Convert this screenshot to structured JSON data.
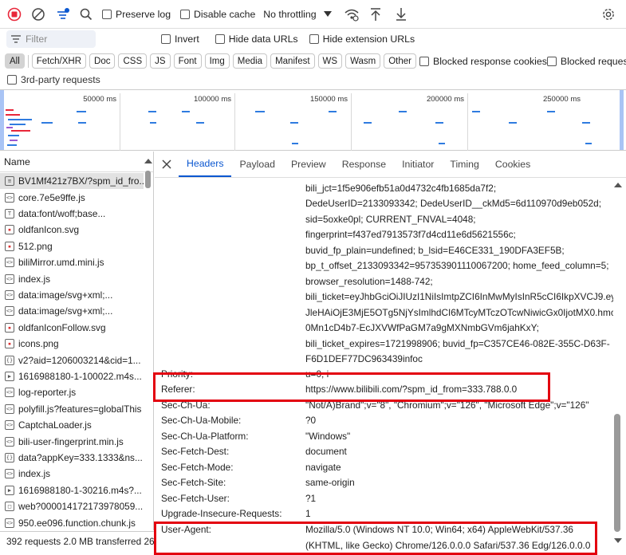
{
  "toolbar": {
    "preserve_log": "Preserve log",
    "disable_cache": "Disable cache",
    "throttling": "No throttling"
  },
  "filter": {
    "placeholder": "Filter",
    "invert": "Invert",
    "hide_data_urls": "Hide data URLs",
    "hide_extension_urls": "Hide extension URLs"
  },
  "types": [
    "All",
    "Fetch/XHR",
    "Doc",
    "CSS",
    "JS",
    "Font",
    "Img",
    "Media",
    "Manifest",
    "WS",
    "Wasm",
    "Other"
  ],
  "blocked_response_cookies": "Blocked response cookies",
  "blocked_requests": "Blocked requests",
  "third_party": "3rd-party requests",
  "overview_ticks": [
    "50000 ms",
    "100000 ms",
    "150000 ms",
    "200000 ms",
    "250000 ms"
  ],
  "name_header": "Name",
  "files": [
    {
      "name": "BV1Mf421z7BX/?spm_id_fro...",
      "icon": "document-icon",
      "selected": true
    },
    {
      "name": "core.7e5e9ffe.js",
      "icon": "script-icon"
    },
    {
      "name": "data:font/woff;base...",
      "icon": "font-icon"
    },
    {
      "name": "oldfanIcon.svg",
      "icon": "image-icon"
    },
    {
      "name": "512.png",
      "icon": "image-icon"
    },
    {
      "name": "biliMirror.umd.mini.js",
      "icon": "script-icon"
    },
    {
      "name": "index.js",
      "icon": "script-icon"
    },
    {
      "name": "data:image/svg+xml;...",
      "icon": "script-icon"
    },
    {
      "name": "data:image/svg+xml;...",
      "icon": "script-icon"
    },
    {
      "name": "oldfanIconFollow.svg",
      "icon": "image-icon"
    },
    {
      "name": "icons.png",
      "icon": "image-icon"
    },
    {
      "name": "v2?aid=1206003214&cid=1...",
      "icon": "fetch-icon"
    },
    {
      "name": "1616988180-1-100022.m4s...",
      "icon": "media-icon"
    },
    {
      "name": "log-reporter.js",
      "icon": "script-icon"
    },
    {
      "name": "polyfill.js?features=globalThis",
      "icon": "script-icon"
    },
    {
      "name": "CaptchaLoader.js",
      "icon": "script-icon"
    },
    {
      "name": "bili-user-fingerprint.min.js",
      "icon": "script-icon"
    },
    {
      "name": "data?appKey=333.1333&ns...",
      "icon": "fetch-icon"
    },
    {
      "name": "index.js",
      "icon": "script-icon"
    },
    {
      "name": "1616988180-1-30216.m4s?...",
      "icon": "media-icon"
    },
    {
      "name": "web?000014172173978059...",
      "icon": "other-icon"
    },
    {
      "name": "950.ee096.function.chunk.js",
      "icon": "script-icon"
    }
  ],
  "status": "392 requests  2.0 MB transferred  26",
  "tabs": [
    "Headers",
    "Payload",
    "Preview",
    "Response",
    "Initiator",
    "Timing",
    "Cookies"
  ],
  "cookie_lines": [
    "bili_jct=1f5e906efb51a0d4732c4fb1685da7f2;",
    "DedeUserID=2133093342; DedeUserID__ckMd5=6d110970d9eb052d;",
    "sid=5oxke0pl; CURRENT_FNVAL=4048;",
    "fingerprint=f437ed7913573f7d4cd11e6d5621556c;",
    "buvid_fp_plain=undefined; b_lsid=E46CE331_190DFA3EF5B;",
    "bp_t_offset_2133093342=957353901110067200; home_feed_column=5;",
    "browser_resolution=1488-742;",
    "bili_ticket=eyJhbGciOiJIUzI1NiIsImtpZCI6InMwMyIsInR5cCI6IkpXVCJ9.ey",
    "JleHAiOjE3MjE5OTg5NjYsImlhdCI6MTcyMTczOTcwNiwicGx0IjotMX0.hmc",
    "0Mn1cD4b7-EcJXVWfPaGM7a9gMXNmbGVm6jahKxY;",
    "bili_ticket_expires=1721998906; buvid_fp=C357CE46-082E-355C-D63F-",
    "F6D1DEF77DC963439infoc"
  ],
  "headers": [
    {
      "key": "Priority:",
      "value": "u=0, i"
    },
    {
      "key": "Referer:",
      "value": "https://www.bilibili.com/?spm_id_from=333.788.0.0"
    },
    {
      "key": "Sec-Ch-Ua:",
      "value": "\"Not/A)Brand\";v=\"8\", \"Chromium\";v=\"126\", \"Microsoft Edge\";v=\"126\""
    },
    {
      "key": "Sec-Ch-Ua-Mobile:",
      "value": "?0"
    },
    {
      "key": "Sec-Ch-Ua-Platform:",
      "value": "\"Windows\""
    },
    {
      "key": "Sec-Fetch-Dest:",
      "value": "document"
    },
    {
      "key": "Sec-Fetch-Mode:",
      "value": "navigate"
    },
    {
      "key": "Sec-Fetch-Site:",
      "value": "same-origin"
    },
    {
      "key": "Sec-Fetch-User:",
      "value": "?1"
    },
    {
      "key": "Upgrade-Insecure-Requests:",
      "value": "1"
    },
    {
      "key": "User-Agent:",
      "value": "Mozilla/5.0 (Windows NT 10.0; Win64; x64) AppleWebKit/537.36"
    }
  ],
  "user_agent_cont": "(KHTML, like Gecko) Chrome/126.0.0.0 Safari/537.36 Edg/126.0.0.0",
  "colors": {
    "record": "#e8273a",
    "accent": "#0b57d0",
    "highlight": "#e3000f"
  }
}
